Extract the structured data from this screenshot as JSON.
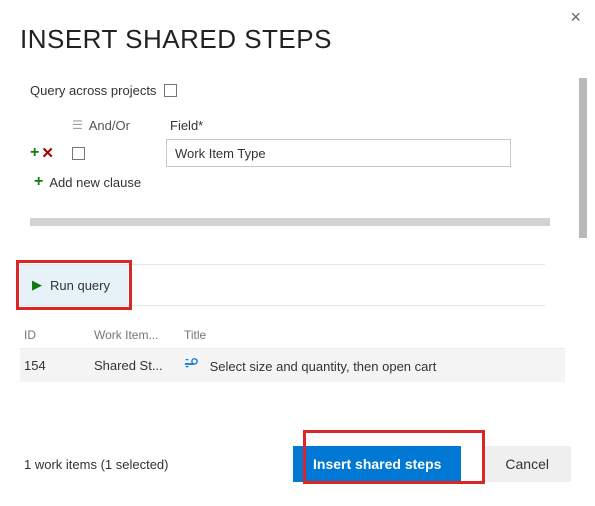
{
  "dialog": {
    "title": "INSERT SHARED STEPS",
    "close_icon": "×"
  },
  "query": {
    "across_projects_label": "Query across projects",
    "header": {
      "andor": "And/Or",
      "field": "Field*"
    },
    "clause": {
      "field_value": "Work Item Type"
    },
    "add_clause": "Add new clause"
  },
  "run_query": {
    "label": "Run query"
  },
  "results": {
    "columns": {
      "id": "ID",
      "wit": "Work Item...",
      "title": "Title"
    },
    "rows": [
      {
        "id": "154",
        "wit": "Shared St...",
        "title": "Select size and quantity, then open cart"
      }
    ]
  },
  "footer": {
    "status": "1 work items (1 selected)",
    "primary": "Insert shared steps",
    "cancel": "Cancel"
  }
}
